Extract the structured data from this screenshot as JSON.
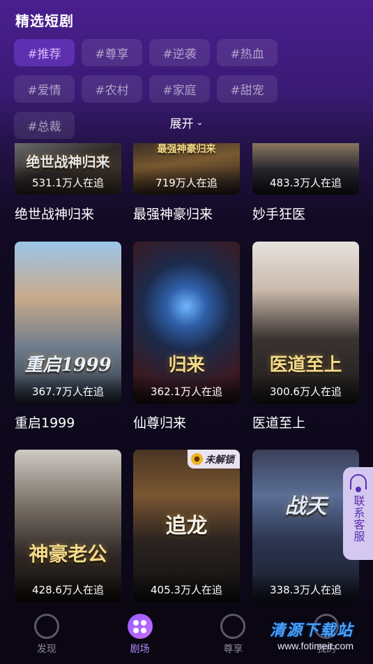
{
  "header": {
    "title": "精选短剧"
  },
  "tags": [
    "#推荐",
    "#尊享",
    "#逆袭",
    "#热血",
    "#爱情",
    "#农村",
    "#家庭",
    "#甜宠",
    "#总裁"
  ],
  "active_tag": "#推荐",
  "expand_label": "展开",
  "rows": [
    [
      {
        "name": "绝世战神归来",
        "views": "531.1万人在追",
        "poster_text": "绝世战神归来"
      },
      {
        "name": "最强神豪归来",
        "views": "719万人在追",
        "poster_text": "最强神豪归来"
      },
      {
        "name": "妙手狂医",
        "views": "483.3万人在追",
        "poster_text": ""
      }
    ],
    [
      {
        "name": "重启1999",
        "views": "367.7万人在追",
        "poster_text": "重启1999"
      },
      {
        "name": "仙尊归来",
        "views": "362.1万人在追",
        "poster_text": "归来"
      },
      {
        "name": "医道至上",
        "views": "300.6万人在追",
        "poster_text": "医道至上"
      }
    ],
    [
      {
        "name": "",
        "views": "428.6万人在追",
        "poster_text": "神豪老公"
      },
      {
        "name": "",
        "views": "405.3万人在追",
        "poster_text": "追龙",
        "badge": "未解锁"
      },
      {
        "name": "",
        "views": "338.3万人在追",
        "poster_text": "战天"
      }
    ]
  ],
  "customer_service": "联系客服",
  "nav": [
    {
      "label": "发现",
      "icon": "discover-icon"
    },
    {
      "label": "剧场",
      "icon": "theater-icon"
    },
    {
      "label": "尊享",
      "icon": "vip-icon"
    },
    {
      "label": "我的",
      "icon": "profile-icon"
    }
  ],
  "active_nav": "剧场",
  "watermark": {
    "main": "清源下载站",
    "url": "www.fotimeit.com"
  },
  "colors": {
    "accent": "#9a5bff",
    "tag_active_text": "#d9b8ff",
    "bg_top": "#4a1f8f",
    "bg_bottom": "#0b0716"
  }
}
